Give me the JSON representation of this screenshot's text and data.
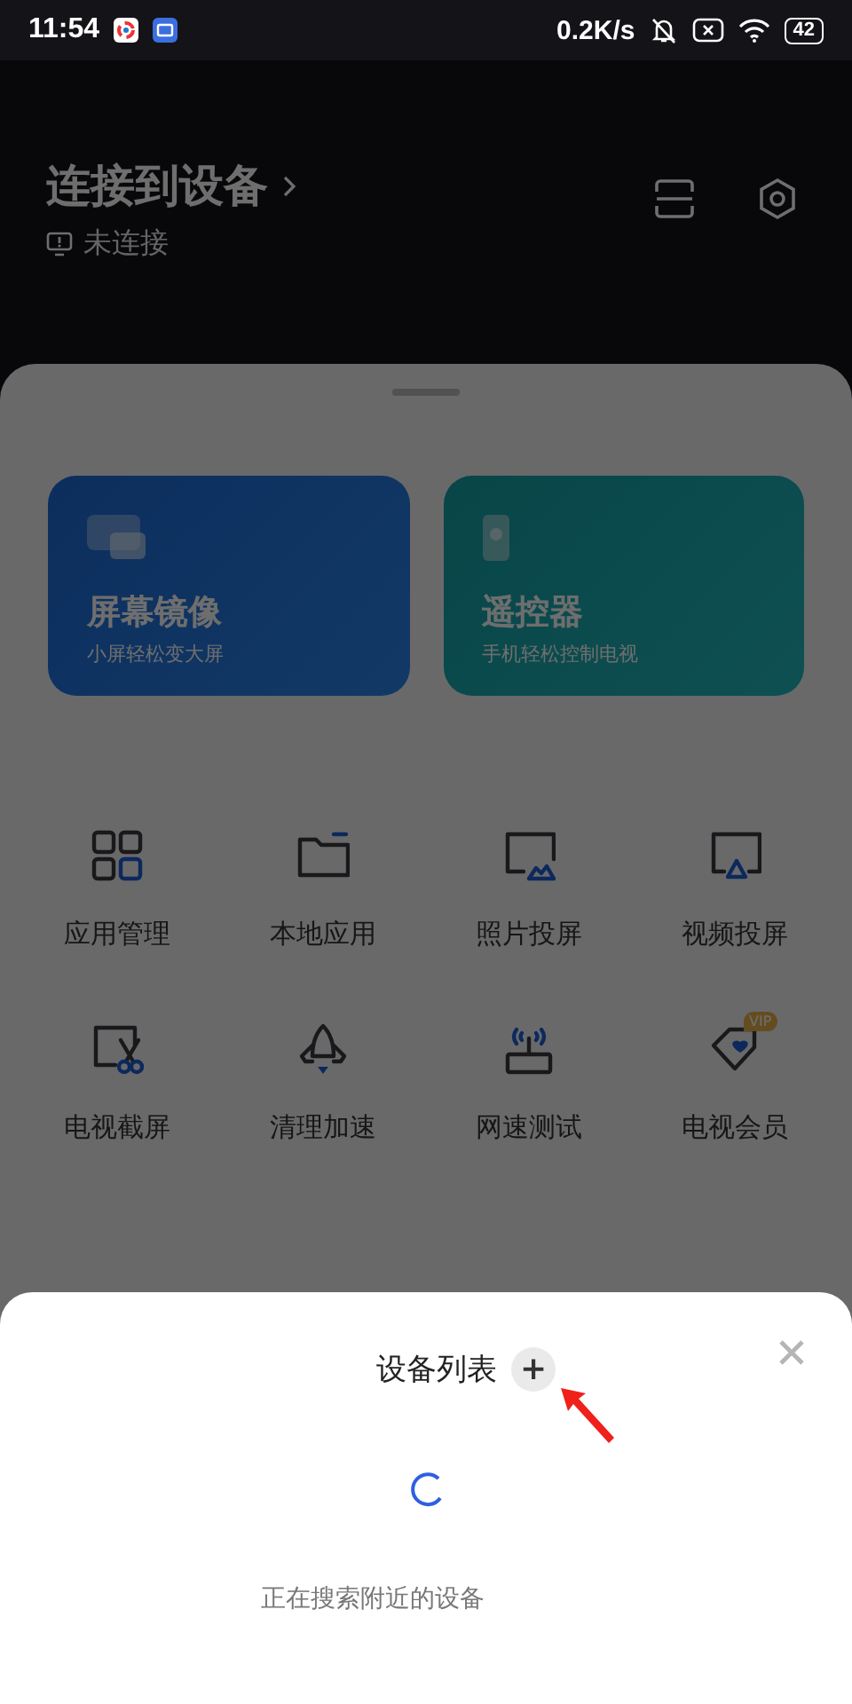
{
  "status_bar": {
    "time": "11:54",
    "speed": "0.2K/s",
    "battery": "42"
  },
  "header": {
    "title": "连接到设备",
    "status": "未连接"
  },
  "cards": [
    {
      "kind": "mirror",
      "title": "屏幕镜像",
      "subtitle": "小屏轻松变大屏"
    },
    {
      "kind": "remote",
      "title": "遥控器",
      "subtitle": "手机轻松控制电视"
    }
  ],
  "tools": [
    {
      "kind": "apps",
      "label": "应用管理"
    },
    {
      "kind": "folder",
      "label": "本地应用"
    },
    {
      "kind": "photo",
      "label": "照片投屏"
    },
    {
      "kind": "video",
      "label": "视频投屏"
    },
    {
      "kind": "screenshot",
      "label": "电视截屏"
    },
    {
      "kind": "rocket",
      "label": "清理加速"
    },
    {
      "kind": "router",
      "label": "网速测试"
    },
    {
      "kind": "vip",
      "label": "电视会员",
      "badge": "VIP"
    }
  ],
  "dialog": {
    "title": "设备列表",
    "add": "+",
    "message": "正在搜索附近的设备"
  }
}
